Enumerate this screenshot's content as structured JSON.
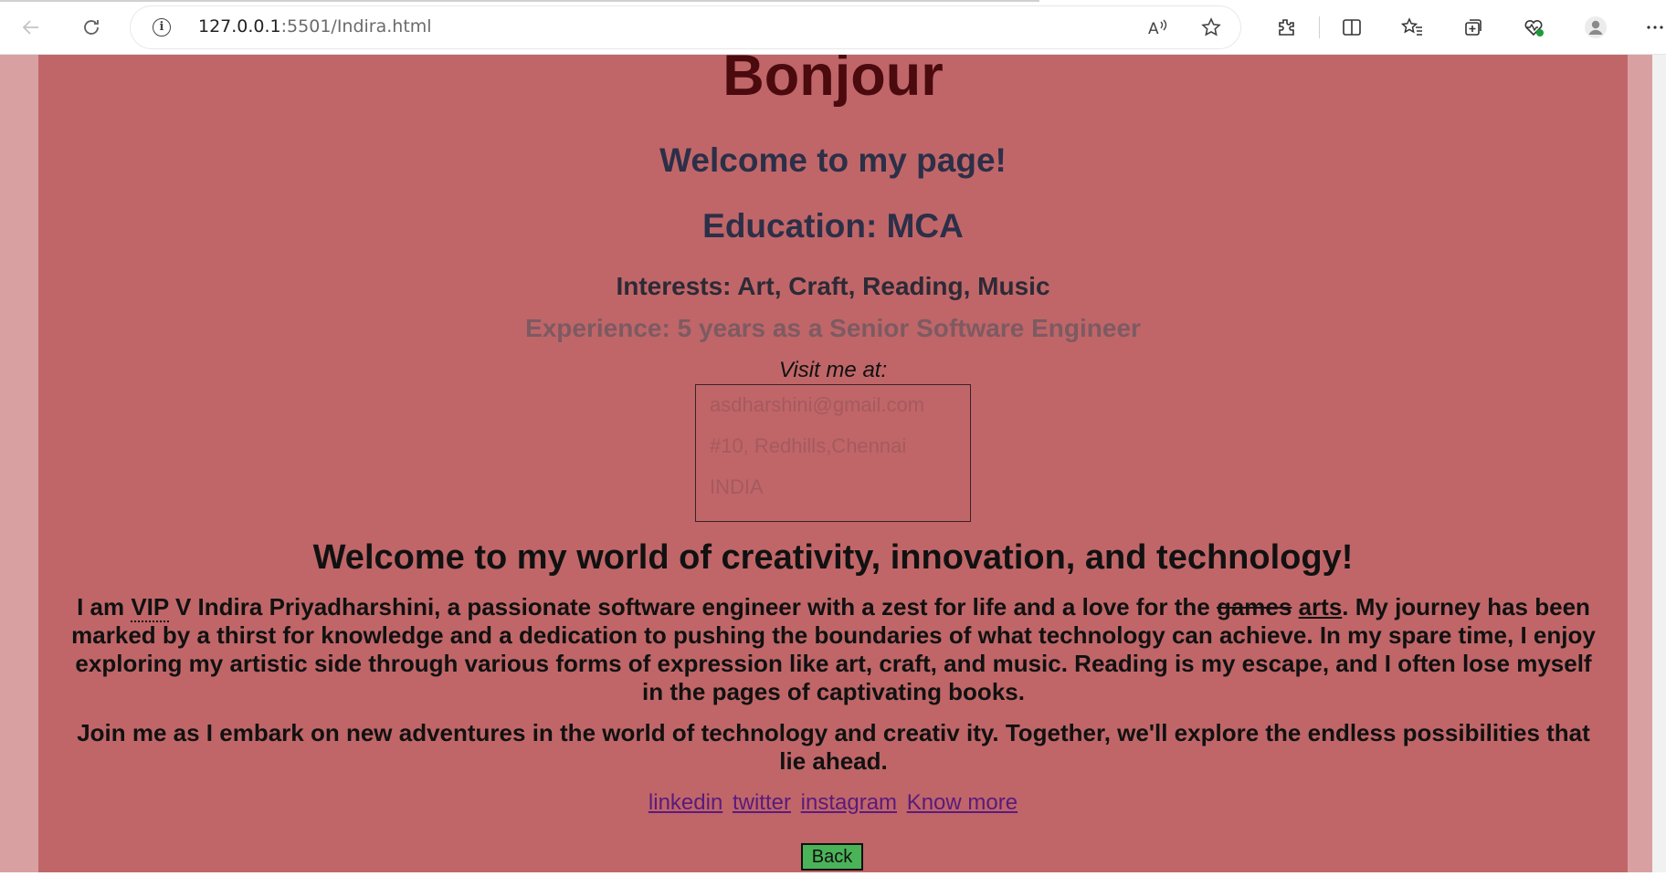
{
  "browser": {
    "url_host": "127.0.0.1",
    "url_rest": ":5501/Indira.html",
    "info_glyph": "i",
    "icons": [
      "back-arrow-icon",
      "refresh-icon",
      "info-icon",
      "read-aloud-icon",
      "favorite-star-icon",
      "extensions-icon",
      "split-screen-icon",
      "favorites-icon",
      "collections-icon",
      "browser-essentials-icon",
      "profile-icon",
      "more-icon"
    ]
  },
  "page": {
    "background": "#c06668",
    "title": "Bonjour",
    "welcome": "Welcome to my page!",
    "education": "Education: MCA",
    "interests": "Interests: Art, Craft, Reading, Music",
    "experience": "Experience: 5 years as a Senior Software Engineer",
    "visit_label": "Visit me at:",
    "contact": {
      "email": "asdharshini@gmail.com",
      "address": "#10, Redhills,Chennai",
      "country": "INDIA"
    },
    "headline": "Welcome to my world of creativity, innovation, and technology!",
    "bio": {
      "prefix": "I am ",
      "abbr": "VIP",
      "after_abbr": " V Indira Priyadharshini, a passionate software engineer with a zest for life and a love for the ",
      "struck": "games",
      "space": " ",
      "inserted": "arts",
      "rest": ". My journey has been marked by a thirst for knowledge and a dedication to pushing the boundaries of what technology can achieve. In my spare time, I enjoy exploring my artistic side through various forms of expression like art, craft, and music. Reading is my escape, and I often lose myself in the pages of captivating books."
    },
    "join_text": "Join me as I embark on new adventures in the world of technology and creativ ity. Together, we'll explore the endless possibilities that lie ahead.",
    "links": [
      "linkedin",
      "twitter",
      "instagram",
      "Know more"
    ],
    "back_label": "Back"
  }
}
